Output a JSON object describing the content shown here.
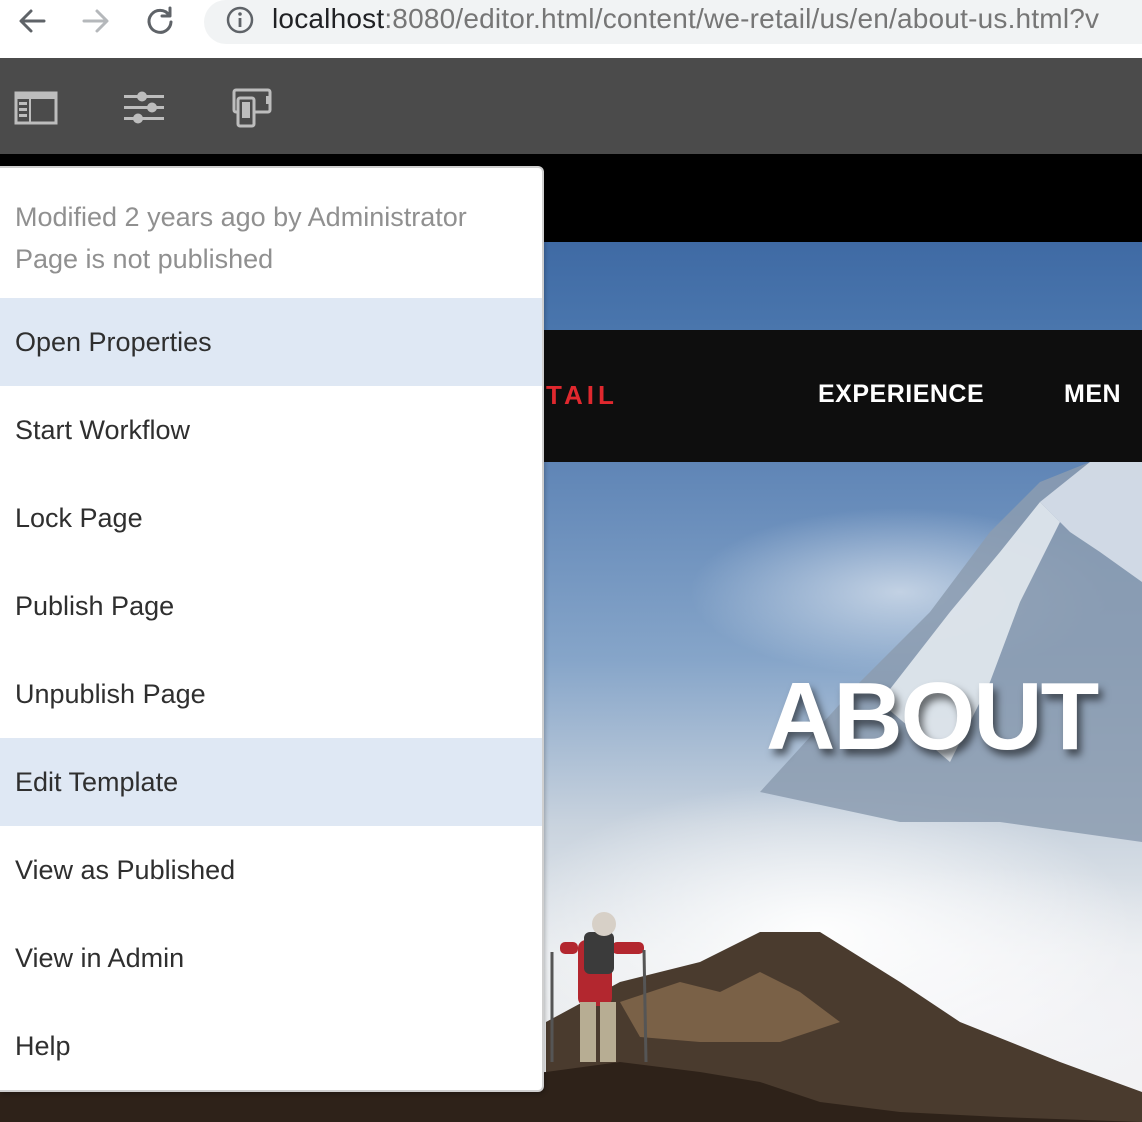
{
  "browser": {
    "url_host": "localhost",
    "url_rest": ":8080/editor.html/content/we-retail/us/en/about-us.html?v",
    "icons": [
      "back-arrow-icon",
      "forward-arrow-icon",
      "reload-icon",
      "info-icon"
    ]
  },
  "toolbar": {
    "icons": [
      "side-panel-icon",
      "page-properties-sliders-icon",
      "emulator-device-icon"
    ]
  },
  "site": {
    "brand_fragment": "TAIL",
    "nav": [
      "EXPERIENCE",
      "MEN"
    ],
    "hero_title": "ABOUT"
  },
  "menu": {
    "info_modified": "Modified 2 years ago by Administrator",
    "info_status": "Page is not published",
    "items": [
      "Open Properties",
      "Start Workflow",
      "Lock Page",
      "Publish Page",
      "Unpublish Page",
      "Edit Template",
      "View as Published",
      "View in Admin",
      "Help"
    ]
  },
  "colors": {
    "toolbar_bg": "#4b4b4b",
    "menu_highlight": "#dfe8f4",
    "brand_red": "#e0282e"
  }
}
